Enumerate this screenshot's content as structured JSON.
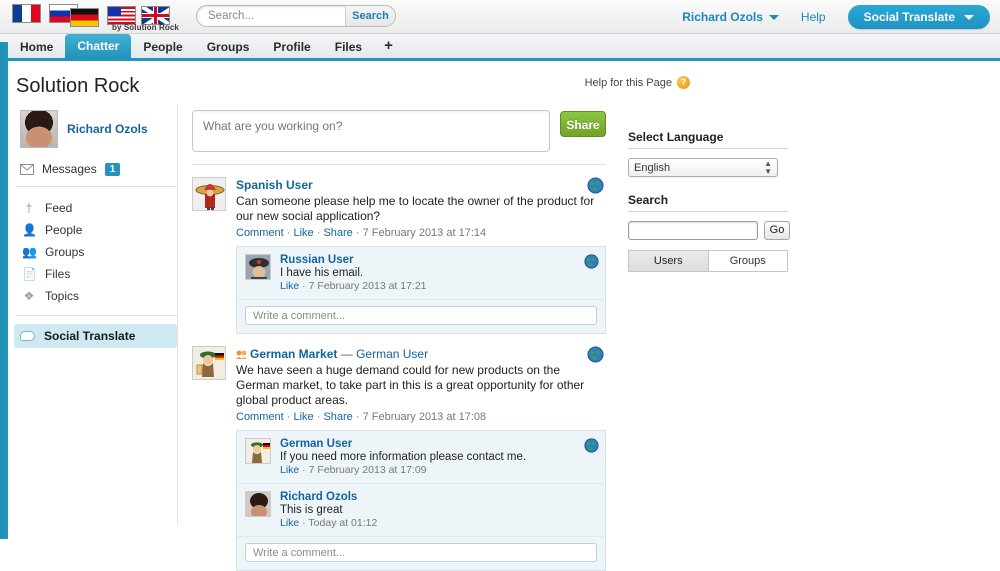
{
  "header": {
    "flags": [
      "flag-france",
      "flag-russia",
      "flag-germany",
      "flag-usa",
      "flag-uk"
    ],
    "tagline": "by Solution Rock",
    "search_placeholder": "Search...",
    "search_value": "",
    "search_button": "Search",
    "user_menu": "Richard Ozols",
    "help_link": "Help",
    "app_menu": "Social Translate"
  },
  "tabs": [
    {
      "label": "Home",
      "active": false
    },
    {
      "label": "Chatter",
      "active": true
    },
    {
      "label": "People",
      "active": false
    },
    {
      "label": "Groups",
      "active": false
    },
    {
      "label": "Profile",
      "active": false
    },
    {
      "label": "Files",
      "active": false
    },
    {
      "label": "+",
      "active": false
    }
  ],
  "page": {
    "title": "Solution Rock",
    "help_for_page": "Help for this Page",
    "help_badge": "?"
  },
  "sidebar": {
    "user_name": "Richard Ozols",
    "messages_label": "Messages",
    "messages_count": "1",
    "nav": [
      {
        "label": "Feed",
        "icon": "feed-icon"
      },
      {
        "label": "People",
        "icon": "person-icon"
      },
      {
        "label": "Groups",
        "icon": "people-icon"
      },
      {
        "label": "Files",
        "icon": "file-icon"
      },
      {
        "label": "Topics",
        "icon": "topics-icon"
      }
    ],
    "apps": [
      {
        "label": "Social Translate",
        "icon": "cloud-icon",
        "active": true
      }
    ]
  },
  "composer": {
    "placeholder": "What are you working on?",
    "value": "",
    "share_button": "Share"
  },
  "feed": [
    {
      "author": "Spanish User",
      "avatar": "spanish-user-avatar",
      "group": "",
      "text": "Can someone please help me to locate the owner of the product for our new social application?",
      "actions": [
        "Comment",
        "Like",
        "Share"
      ],
      "timestamp": "7 February 2013 at 17:14",
      "translate_icon": "globe-icon",
      "comments": [
        {
          "author": "Russian User",
          "avatar": "russian-user-avatar",
          "text": "I have his email.",
          "action": "Like",
          "timestamp": "7 February 2013 at 17:21",
          "translate_icon": "globe-icon"
        }
      ],
      "comment_placeholder": "Write a comment..."
    },
    {
      "author": "German Market",
      "avatar": "german-user-avatar",
      "group_icon": "group-icon",
      "separator": "—",
      "group": "German User",
      "text": "We have seen a huge demand could for new products on the German market, to take part in this is a great opportunity for other global product areas.",
      "actions": [
        "Comment",
        "Like",
        "Share"
      ],
      "timestamp": "7 February 2013 at 17:08",
      "translate_icon": "globe-icon",
      "comments": [
        {
          "author": "German User",
          "avatar": "german-user-avatar",
          "text": "If you need more information please contact me.",
          "action": "Like",
          "timestamp": "7 February 2013 at 17:09",
          "translate_icon": "globe-icon"
        },
        {
          "author": "Richard Ozols",
          "avatar": "richard-ozols-avatar",
          "text": "This is great",
          "action": "Like",
          "timestamp": "Today at 01:12",
          "translate_icon": ""
        }
      ],
      "comment_placeholder": "Write a comment..."
    }
  ],
  "right_panel": {
    "language_heading": "Select Language",
    "language_selected": "English",
    "search_heading": "Search",
    "search_value": "",
    "go_button": "Go",
    "result_tabs": [
      {
        "label": "Users",
        "active": true
      },
      {
        "label": "Groups",
        "active": false
      }
    ]
  },
  "colors": {
    "accent": "#2394bd",
    "link": "#1463a0",
    "share_green": "#8dc63f",
    "badge_blue": "#2394bd"
  }
}
